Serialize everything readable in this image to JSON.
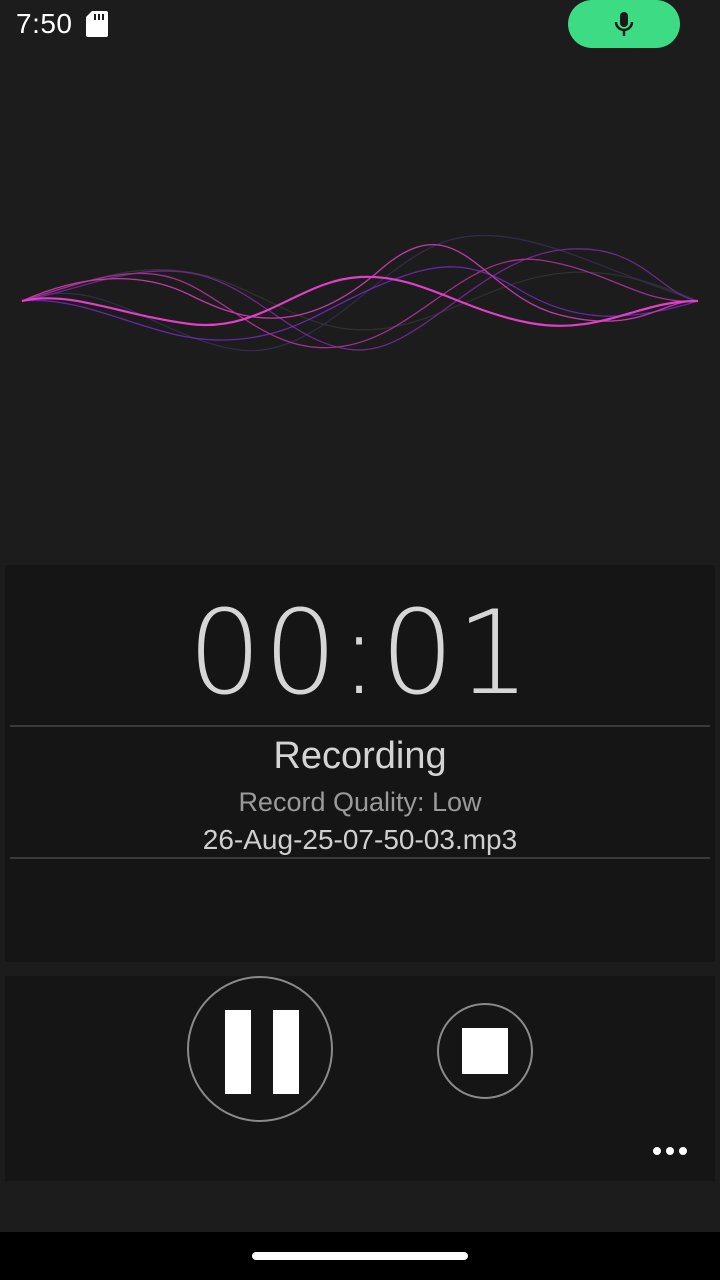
{
  "status_bar": {
    "time": "7:50",
    "sd_icon": "sd-card-icon",
    "mic_indicator_icon": "mic-icon",
    "mic_indicator_color": "#3ddc84"
  },
  "recorder": {
    "timer": "00:01",
    "status": "Recording",
    "quality": "Record Quality: Low",
    "filename": "26-Aug-25-07-50-03.mp3"
  },
  "controls": {
    "pause_icon": "pause-icon",
    "stop_icon": "stop-icon",
    "more_icon": "more-horizontal-icon"
  },
  "colors": {
    "background": "#1c1c1c",
    "panel": "#151515",
    "wave_primary": "#e040c8",
    "wave_secondary": "#6a3ad0"
  }
}
